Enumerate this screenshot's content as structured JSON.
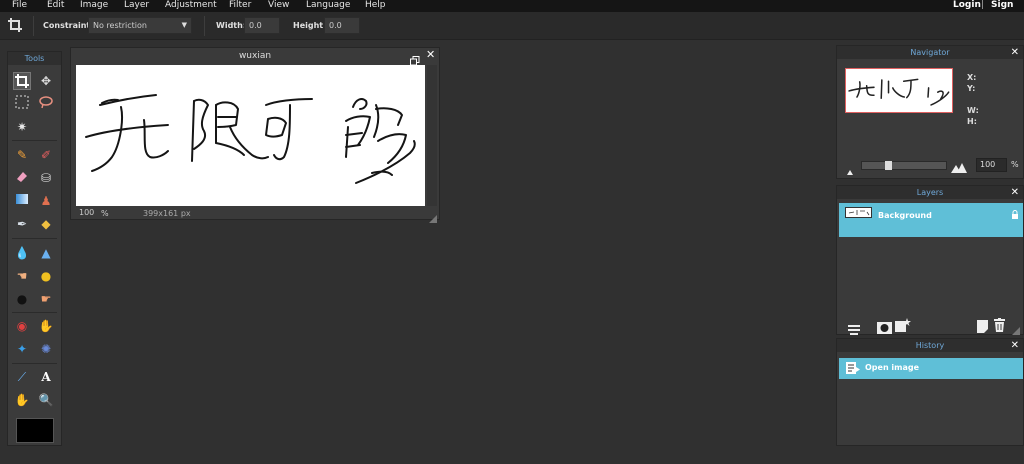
{
  "menu": {
    "items": [
      "File",
      "Edit",
      "Image",
      "Layer",
      "Adjustment",
      "Filter",
      "View",
      "Language",
      "Help"
    ],
    "login": "Login",
    "separator": "|",
    "signup": "Sign up"
  },
  "options": {
    "constraint_label": "Constraint:",
    "constraint_value": "No restriction",
    "width_label": "Width:",
    "width_value": "0.0",
    "height_label": "Height:",
    "height_value": "0.0"
  },
  "tools": {
    "title": "Tools",
    "text_tool_glyph": "A"
  },
  "image_window": {
    "title": "wuxian",
    "zoom": "100",
    "zoom_unit": "%",
    "dimensions": "399x161 px"
  },
  "navigator": {
    "title": "Navigator",
    "x_label": "X:",
    "y_label": "Y:",
    "w_label": "W:",
    "h_label": "H:",
    "zoom_value": "100",
    "zoom_unit": "%",
    "zoom_level_fraction": 0.3
  },
  "layers": {
    "title": "Layers",
    "items": [
      {
        "name": "Background"
      }
    ]
  },
  "history": {
    "title": "History",
    "items": [
      {
        "name": "Open image"
      }
    ]
  },
  "colors": {
    "selection": "#5fbfd7",
    "accent_title": "#6fa8d8",
    "foreground_swatch": "#000000"
  }
}
